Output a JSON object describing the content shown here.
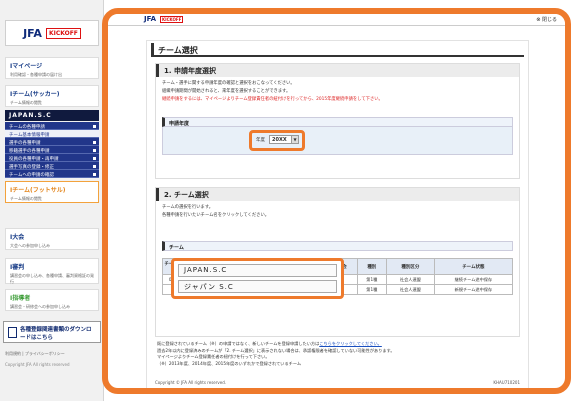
{
  "brand": {
    "jfa": "JFA",
    "kickoff": "KICKOFF"
  },
  "sidebar": {
    "mypage": {
      "title": "Iマイページ",
      "sub": "利用確認・各種申請の届け出"
    },
    "team_soccer": {
      "title": "Iチーム(サッカー)",
      "sub": "チーム情報の閲覧"
    },
    "bar": "JAPAN.S.C",
    "menu": [
      "チームの各種申請",
      "チーム基本情報申請",
      "選手の各種申請",
      "移籍選手の各種申請",
      "役員の各種申請・再申請",
      "選手写真の登録・修正",
      "チームへの申請の確認"
    ],
    "team_futsal": {
      "title": "Iチーム(フットサル)",
      "sub": "チーム情報の閲覧"
    },
    "taikai": {
      "title": "I大会",
      "sub": "大会への参加申し込み"
    },
    "shikaku": {
      "title": "I審判",
      "sub": "講習会の申し込み、各種申請、審判資格証の発行"
    },
    "shidosha": {
      "title": "I指導者",
      "sub": "講習会・研修会への参加申し込み"
    },
    "download": "各種登録関連書類のダウンロードはこちら",
    "footer1": "利用規約 | プライバシーポリシー",
    "footer2": "Copyright JFA All rights reserved"
  },
  "header": {
    "close": "⊗ 閉じる"
  },
  "page": {
    "title": "チーム選択",
    "sec1": {
      "title": "1. 申請年度選択",
      "lines": [
        "チーム・選手に関する申請年度の確認と選択をおこなってください。",
        "組織申請期間が開始されると、来年度を選択することができます。"
      ],
      "red": "継続申請をするには、マイページよりチーム登録責任者の紐付けを行ってから、2015年度継続申請をして下さい。",
      "subhead": "申請年度",
      "year_label": "年度",
      "year_value": "20XX"
    },
    "sec2": {
      "title": "2. チーム選択",
      "lines": [
        "チームの選択を行います。",
        "各種申請を行いたいチーム名をクリックしてください。"
      ],
      "subhead": "チーム",
      "columns": [
        "チーム登録番号",
        "チーム名",
        "所属協会",
        "種別",
        "種別区分",
        "チーム状態"
      ],
      "rows": [
        [
          "01235",
          "",
          "…協会",
          "第1種",
          "社会人連盟",
          "継続チーム途中保存"
        ],
        [
          "",
          "",
          "…協会",
          "第1種",
          "社会人連盟",
          "新規チーム途中保存"
        ]
      ],
      "teams": [
        "JAPAN.S.C",
        "ジャパン S.C"
      ]
    },
    "notes": {
      "l1a": "既に登録されているチーム（※）の申請ではなく、新しいチームを登録申請したい方は",
      "l1b": "こちらをクリックしてください。",
      "l2": "過去2年以内に登録済みのチームが「2. チーム選択」に表示されない場合は、承認権限者を確認していない可能性があります。",
      "l3": "マイページよりチーム登録責任者の紐付けを行って下さい。",
      "l4": "（※）2013年度、2014年度、2015年度のいずれかで登録されているチーム"
    },
    "copyright": "Copyright © JFA All rights reserved.",
    "code": "KHAU710201"
  }
}
